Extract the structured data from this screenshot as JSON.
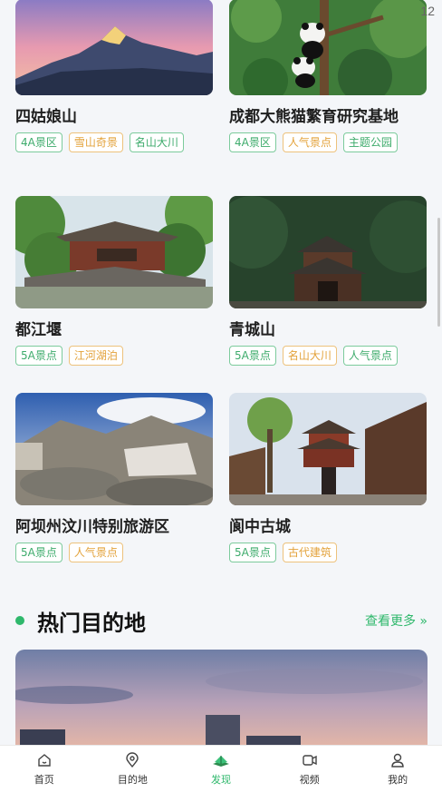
{
  "page_indicator": "12",
  "cards": [
    {
      "name": "四姑娘山",
      "tags": [
        {
          "text": "4A景区",
          "color": "green"
        },
        {
          "text": "雪山奇景",
          "color": "orange"
        },
        {
          "text": "名山大川",
          "color": "green"
        }
      ]
    },
    {
      "name": "成都大熊猫繁育研究基地",
      "tags": [
        {
          "text": "4A景区",
          "color": "green"
        },
        {
          "text": "人气景点",
          "color": "orange"
        },
        {
          "text": "主题公园",
          "color": "green"
        }
      ]
    },
    {
      "name": "都江堰",
      "tags": [
        {
          "text": "5A景点",
          "color": "green"
        },
        {
          "text": "江河湖泊",
          "color": "orange"
        }
      ]
    },
    {
      "name": "青城山",
      "tags": [
        {
          "text": "5A景点",
          "color": "green"
        },
        {
          "text": "名山大川",
          "color": "orange"
        },
        {
          "text": "人气景点",
          "color": "green"
        }
      ]
    },
    {
      "name": "阿坝州汶川特别旅游区",
      "tags": [
        {
          "text": "5A景点",
          "color": "green"
        },
        {
          "text": "人气景点",
          "color": "orange"
        }
      ]
    },
    {
      "name": "阆中古城",
      "tags": [
        {
          "text": "5A景点",
          "color": "green"
        },
        {
          "text": "古代建筑",
          "color": "orange"
        }
      ]
    }
  ],
  "section": {
    "title": "热门目的地",
    "more": "查看更多 »"
  },
  "tabbar": {
    "items": [
      {
        "label": "首页",
        "icon": "home-icon"
      },
      {
        "label": "目的地",
        "icon": "location-pin-icon"
      },
      {
        "label": "发现",
        "icon": "open-book-icon",
        "active": true
      },
      {
        "label": "视频",
        "icon": "video-icon"
      },
      {
        "label": "我的",
        "icon": "user-icon"
      }
    ]
  },
  "colors": {
    "accent_green": "#2fb86c",
    "tag_green": "#3dab6b",
    "tag_orange": "#e3a23a",
    "background": "#f4f6f9"
  }
}
